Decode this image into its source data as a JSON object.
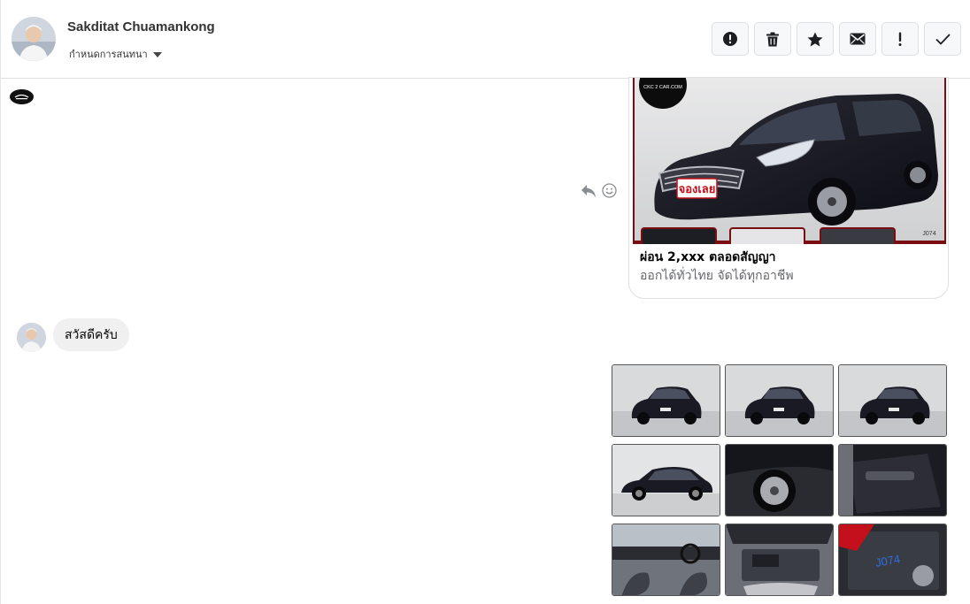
{
  "header": {
    "name": "Sakditat Chuamankong",
    "label_dropdown": "กำหนดการสนทนา",
    "toolbar": [
      {
        "icon": "alert-circle-icon"
      },
      {
        "icon": "trash-icon"
      },
      {
        "icon": "star-icon"
      },
      {
        "icon": "envelope-icon"
      },
      {
        "icon": "exclamation-icon"
      },
      {
        "icon": "checkmark-icon"
      }
    ]
  },
  "conversation": {
    "card": {
      "title": "ผ่อน 2,xxx ตลอดสัญญา",
      "description": "ออกได้ทั่วไทย จัดได้ทุกอาชีพ",
      "image": {
        "brand_text": "CKC 2 CAR.COM",
        "sticker_text": "จองเลย",
        "code_text": "J074"
      }
    },
    "incoming_message": "สวัสดีครับ",
    "photo_grid": {
      "count": 9,
      "photos": [
        {
          "subject": "front-left-view"
        },
        {
          "subject": "front-right-view"
        },
        {
          "subject": "rear-view"
        },
        {
          "subject": "side-view"
        },
        {
          "subject": "wheel-closeup"
        },
        {
          "subject": "door-interior"
        },
        {
          "subject": "dashboard-interior"
        },
        {
          "subject": "engine-bay"
        },
        {
          "subject": "battery-closeup",
          "note_text": "J074"
        }
      ]
    }
  },
  "colors": {
    "accent_red": "#c40f1c",
    "car_body": "#1a1a24",
    "bubble_gray": "#f0f0f0",
    "border": "#dddfe2",
    "muted_text": "#65676b"
  }
}
